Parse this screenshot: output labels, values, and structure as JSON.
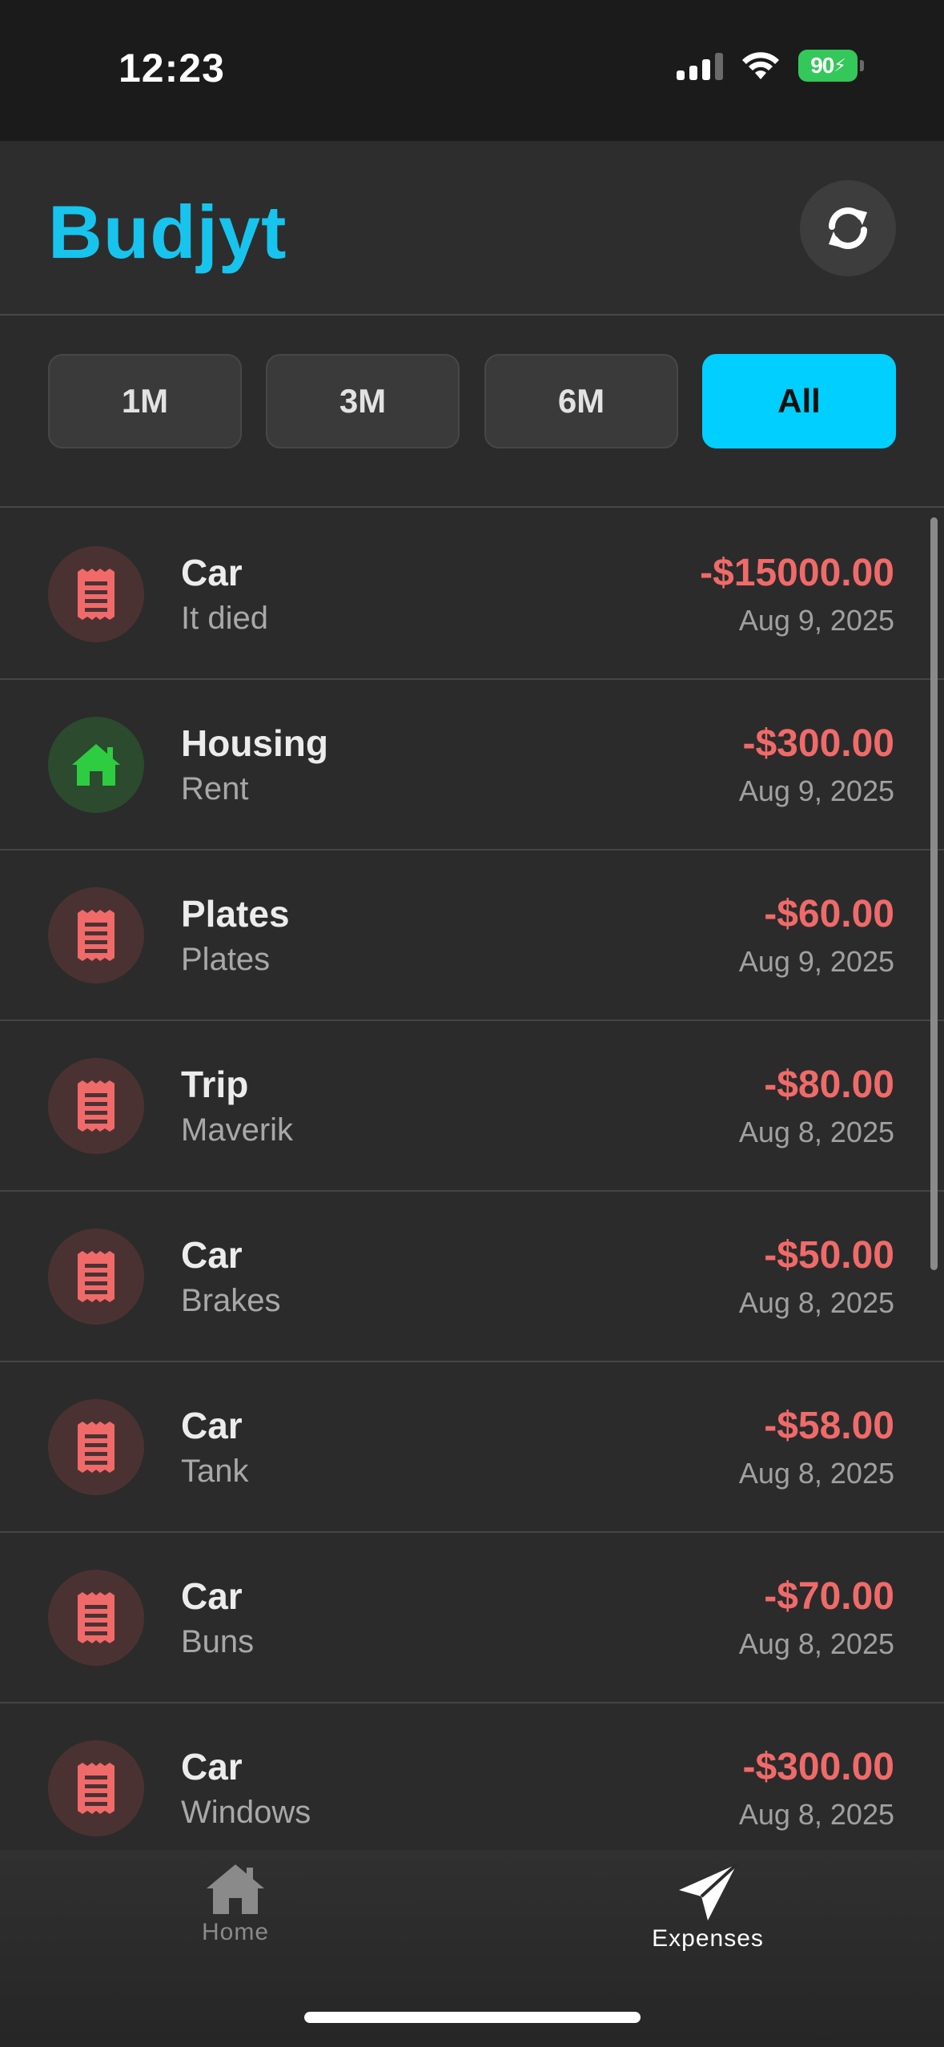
{
  "status_bar": {
    "time": "12:23",
    "battery": "90"
  },
  "header": {
    "title": "Budjyt",
    "refresh_icon": "refresh-icon"
  },
  "filters": [
    {
      "label": "1M",
      "active": false
    },
    {
      "label": "3M",
      "active": false
    },
    {
      "label": "6M",
      "active": false
    },
    {
      "label": "All",
      "active": true
    }
  ],
  "expenses": [
    {
      "category": "Car",
      "description": "It died",
      "amount": "-$15000.00",
      "date": "Aug 9, 2025",
      "icon": "receipt-icon"
    },
    {
      "category": "Housing",
      "description": "Rent",
      "amount": "-$300.00",
      "date": "Aug 9, 2025",
      "icon": "house-icon"
    },
    {
      "category": "Plates",
      "description": "Plates",
      "amount": "-$60.00",
      "date": "Aug 9, 2025",
      "icon": "receipt-icon"
    },
    {
      "category": "Trip",
      "description": "Maverik",
      "amount": "-$80.00",
      "date": "Aug 8, 2025",
      "icon": "receipt-icon"
    },
    {
      "category": "Car",
      "description": "Brakes",
      "amount": "-$50.00",
      "date": "Aug 8, 2025",
      "icon": "receipt-icon"
    },
    {
      "category": "Car",
      "description": "Tank",
      "amount": "-$58.00",
      "date": "Aug 8, 2025",
      "icon": "receipt-icon"
    },
    {
      "category": "Car",
      "description": "Buns",
      "amount": "-$70.00",
      "date": "Aug 8, 2025",
      "icon": "receipt-icon"
    },
    {
      "category": "Car",
      "description": "Windows",
      "amount": "-$300.00",
      "date": "Aug 8, 2025",
      "icon": "receipt-icon"
    }
  ],
  "tabbar": {
    "tabs": [
      {
        "label": "Home",
        "icon": "home-icon",
        "active": false
      },
      {
        "label": "Expenses",
        "icon": "paper-plane-icon",
        "active": true
      }
    ]
  },
  "colors": {
    "accent": "#17c4ee",
    "active_filter": "#00cfff",
    "expense_red": "#f06a6a",
    "housing_green": "#2ecc40"
  }
}
